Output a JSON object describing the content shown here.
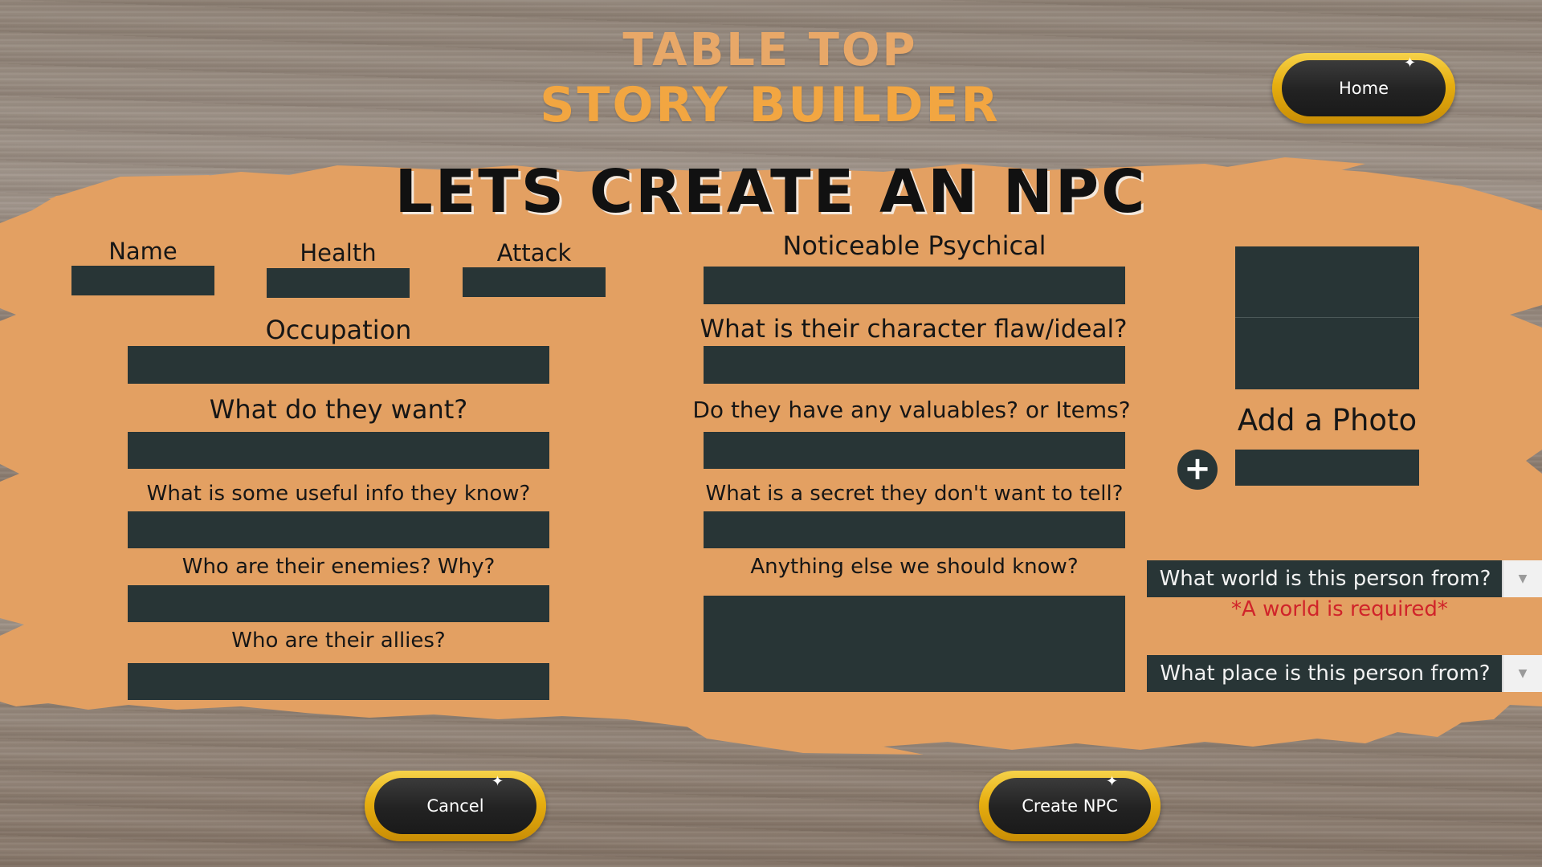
{
  "app": {
    "title_line1": "TABLE TOP",
    "title_line2": "STORY BUILDER",
    "heading": "LETS CREATE AN NPC"
  },
  "nav": {
    "home_label": "Home"
  },
  "form": {
    "name_label": "Name",
    "health_label": "Health",
    "attack_label": "Attack",
    "occupation_label": "Occupation",
    "want_label": "What do they want?",
    "useful_info_label": "What is some useful info they know?",
    "enemies_label": "Who are their enemies? Why?",
    "allies_label": "Who are their allies?",
    "physical_label": "Noticeable Psychical",
    "flaw_label": "What is their character flaw/ideal?",
    "valuables_label": "Do they have any valuables? or Items?",
    "secret_label": "What is a secret they don't want to tell?",
    "anything_else_label": "Anything else we should know?"
  },
  "photo": {
    "label": "Add a Photo"
  },
  "selects": {
    "world_placeholder": "What world is this person from?",
    "world_error": "*A world is required*",
    "place_placeholder": "What place is this person from?"
  },
  "actions": {
    "cancel_label": "Cancel",
    "create_label": "Create NPC"
  },
  "colors": {
    "panel": "#e3a062",
    "field": "#283536",
    "title_top": "#e8a868",
    "title_bottom": "#f2a641",
    "error": "#d0242a",
    "button_gold": "#e6ae10"
  }
}
